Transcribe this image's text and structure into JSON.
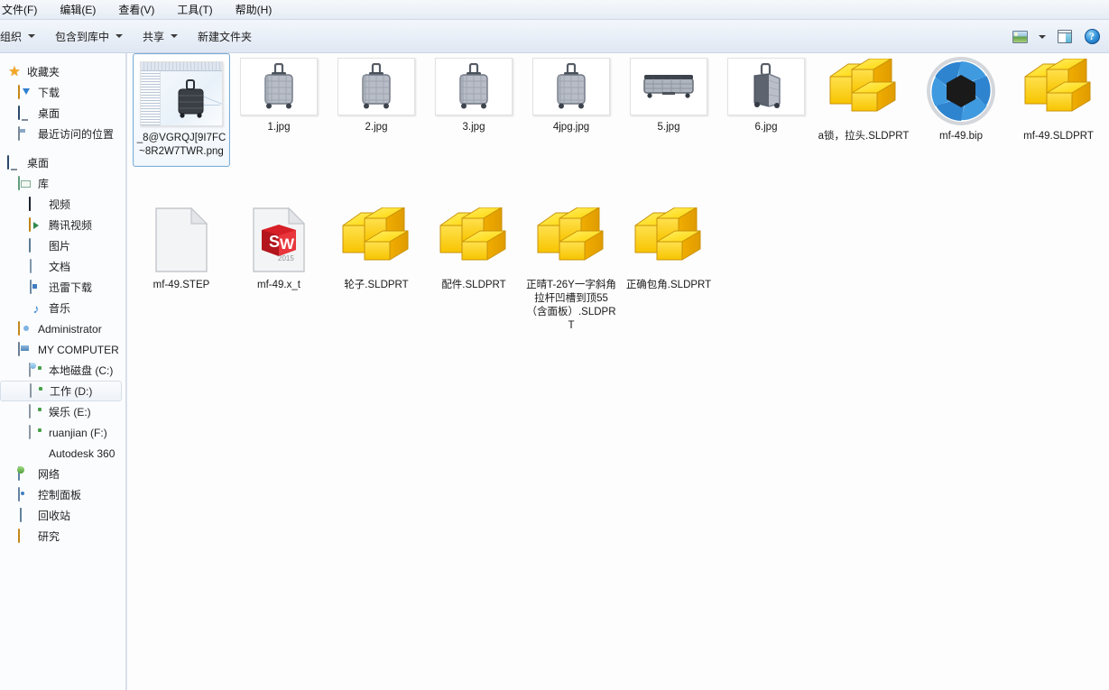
{
  "window": {
    "menus": [
      {
        "label": "文件(F)",
        "name": "menu-file"
      },
      {
        "label": "编辑(E)",
        "name": "menu-edit"
      },
      {
        "label": "查看(V)",
        "name": "menu-view"
      },
      {
        "label": "工具(T)",
        "name": "menu-tools"
      },
      {
        "label": "帮助(H)",
        "name": "menu-help"
      }
    ]
  },
  "toolbar": {
    "organize": "组织",
    "include_in_library": "包含到库中",
    "share": "共享",
    "new_folder": "新建文件夹",
    "view_mode_icon": "view-mode-icon",
    "view_mode_caret_icon": "chevron-down-icon",
    "preview_pane_icon": "preview-pane-icon",
    "help_icon": "help-icon",
    "help_glyph": "?"
  },
  "sidebar": {
    "groups": [
      {
        "name": "favorites",
        "items": [
          {
            "label": "收藏夹",
            "icon": "star-icon",
            "level": 0,
            "selected": false
          },
          {
            "label": "下载",
            "icon": "download-folder-icon",
            "level": 1,
            "selected": false
          },
          {
            "label": "桌面",
            "icon": "desktop-icon",
            "level": 1,
            "selected": false
          },
          {
            "label": "最近访问的位置",
            "icon": "recent-places-icon",
            "level": 1,
            "selected": false
          }
        ]
      },
      {
        "name": "desktop-tree",
        "items": [
          {
            "label": "桌面",
            "icon": "desktop-icon",
            "level": 0,
            "selected": false
          },
          {
            "label": "库",
            "icon": "library-icon",
            "level": 1,
            "selected": false
          },
          {
            "label": "视频",
            "icon": "video-icon",
            "level": 2,
            "selected": false
          },
          {
            "label": "腾讯视频",
            "icon": "tencent-video-icon",
            "level": 2,
            "selected": false
          },
          {
            "label": "图片",
            "icon": "pictures-icon",
            "level": 2,
            "selected": false
          },
          {
            "label": "文档",
            "icon": "documents-icon",
            "level": 2,
            "selected": false
          },
          {
            "label": "迅雷下载",
            "icon": "thunder-download-icon",
            "level": 2,
            "selected": false
          },
          {
            "label": "音乐",
            "icon": "music-icon",
            "level": 2,
            "selected": false
          },
          {
            "label": "Administrator",
            "icon": "user-folder-icon",
            "level": 1,
            "selected": false
          },
          {
            "label": "MY COMPUTER",
            "icon": "computer-icon",
            "level": 1,
            "selected": false
          },
          {
            "label": "本地磁盘 (C:)",
            "icon": "system-drive-icon",
            "level": 2,
            "selected": false
          },
          {
            "label": "工作 (D:)",
            "icon": "drive-icon",
            "level": 2,
            "selected": true
          },
          {
            "label": "娱乐 (E:)",
            "icon": "drive-icon",
            "level": 2,
            "selected": false
          },
          {
            "label": "ruanjian (F:)",
            "icon": "drive-icon",
            "level": 2,
            "selected": false
          },
          {
            "label": "Autodesk 360",
            "icon": "autodesk-360-icon",
            "level": 2,
            "selected": false
          },
          {
            "label": "网络",
            "icon": "network-icon",
            "level": 1,
            "selected": false
          },
          {
            "label": "控制面板",
            "icon": "control-panel-icon",
            "level": 1,
            "selected": false
          },
          {
            "label": "回收站",
            "icon": "recycle-bin-icon",
            "level": 1,
            "selected": false
          },
          {
            "label": "研究",
            "icon": "folder-icon",
            "level": 1,
            "selected": false
          }
        ]
      }
    ]
  },
  "files": [
    {
      "name": "_8@VGRQJ[9I7FC~8R2W7TWR.png",
      "type": "screenshot-thumb",
      "selected": true
    },
    {
      "name": "1.jpg",
      "type": "suitcase-front",
      "selected": false
    },
    {
      "name": "2.jpg",
      "type": "suitcase-front",
      "selected": false
    },
    {
      "name": "3.jpg",
      "type": "suitcase-front",
      "selected": false
    },
    {
      "name": "4jpg.jpg",
      "type": "suitcase-front",
      "selected": false
    },
    {
      "name": "5.jpg",
      "type": "suitcase-flat",
      "selected": false
    },
    {
      "name": "6.jpg",
      "type": "suitcase-angle",
      "selected": false
    },
    {
      "name": "a锁，拉头.SLDPRT",
      "type": "sldprt",
      "selected": false
    },
    {
      "name": "mf-49.bip",
      "type": "keyshot",
      "selected": false
    },
    {
      "name": "mf-49.SLDPRT",
      "type": "sldprt",
      "selected": false
    },
    {
      "name": "mf-49.STEP",
      "type": "blank-doc",
      "selected": false
    },
    {
      "name": "mf-49.x_t",
      "type": "solidworks-doc",
      "selected": false
    },
    {
      "name": "轮子.SLDPRT",
      "type": "sldprt",
      "selected": false
    },
    {
      "name": "配件.SLDPRT",
      "type": "sldprt",
      "selected": false
    },
    {
      "name": "正晴T-26Y一字斜角拉杆凹槽到顶55（含面板）.SLDPRT",
      "type": "sldprt",
      "selected": false
    },
    {
      "name": "正确包角.SLDPRT",
      "type": "sldprt",
      "selected": false
    }
  ],
  "icons": {
    "solidworks_doc_badge": "SW",
    "solidworks_doc_year": "2015"
  },
  "colors": {
    "selection_border": "#7aaed6",
    "sldprt_yellow": "#ffd400",
    "keyshot_blue": "#2f8fd8",
    "sw_red": "#d61f26",
    "toolbar_bg": "#eaf0f8"
  }
}
